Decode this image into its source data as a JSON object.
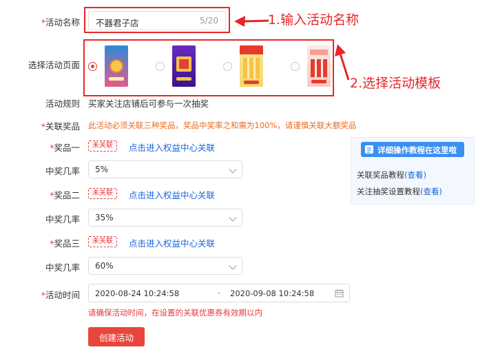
{
  "form": {
    "activity_name": {
      "label": "活动名称",
      "value": "不器君子店",
      "counter": "5/20"
    },
    "page_select": {
      "label": "选择活动页面"
    },
    "rules": {
      "label": "活动规则",
      "text": "买家关注店铺后可参与一次抽奖"
    },
    "prizes": {
      "label": "关联奖品",
      "warning": "此活动必须关联三种奖品，奖品中奖率之和需为100%，请谨慎关联大额奖品",
      "items": [
        {
          "label": "奖品一",
          "status": "未关联",
          "link": "点击进入权益中心关联",
          "rate_label": "中奖几率",
          "rate": "5%"
        },
        {
          "label": "奖品二",
          "status": "未关联",
          "link": "点击进入权益中心关联",
          "rate_label": "中奖几率",
          "rate": "35%"
        },
        {
          "label": "奖品三",
          "status": "未关联",
          "link": "点击进入权益中心关联",
          "rate_label": "中奖几率",
          "rate": "60%"
        }
      ]
    },
    "time": {
      "label": "活动时间",
      "start": "2020-08-24 10:24:58",
      "separator": "-",
      "end": "2020-09-08 10:24:58",
      "hint": "请确保活动时间，在设置的关联优惠券有效期以内"
    },
    "submit_label": "创建活动"
  },
  "help": {
    "title": "详细操作教程在这里啦",
    "lines": [
      {
        "text": "关联奖品教程",
        "link": "(查看)"
      },
      {
        "text": "关注抽奖设置教程",
        "link": "(查看)"
      }
    ]
  },
  "annotations": {
    "step1": "1.输入活动名称",
    "step2": "2.选择活动模板"
  },
  "colors": {
    "accent": "#e4393c",
    "link": "#1a66d9",
    "annotation": "#e8262a",
    "help_header": "#3b8ff3"
  }
}
